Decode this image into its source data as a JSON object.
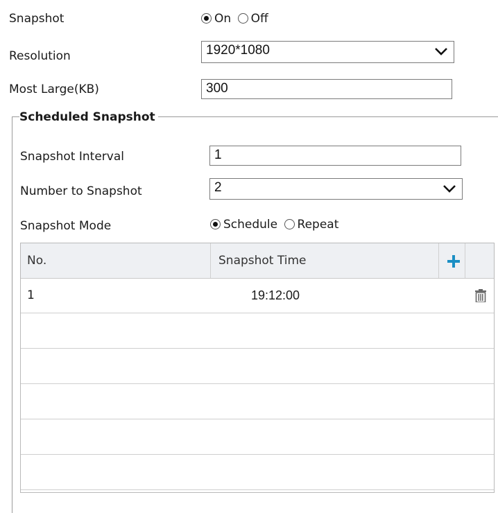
{
  "snapshot": {
    "label": "Snapshot",
    "options": [
      {
        "label": "On",
        "selected": true
      },
      {
        "label": "Off",
        "selected": false
      }
    ]
  },
  "resolution": {
    "label": "Resolution",
    "value": "1920*1080"
  },
  "max_size": {
    "label": "Most Large(KB)",
    "value": "300"
  },
  "scheduled": {
    "legend": "Scheduled Snapshot",
    "interval": {
      "label": "Snapshot Interval",
      "value": "1"
    },
    "number": {
      "label": "Number to Snapshot",
      "value": "2"
    },
    "mode": {
      "label": "Snapshot Mode",
      "options": [
        {
          "label": "Schedule",
          "selected": true
        },
        {
          "label": "Repeat",
          "selected": false
        }
      ]
    }
  },
  "table": {
    "headers": [
      "No.",
      "Snapshot Time"
    ],
    "add_icon": "plus-icon",
    "delete_icon": "trash-icon",
    "rows": [
      {
        "no": "1",
        "time": "19:12:00"
      }
    ],
    "empty_rows": 5
  },
  "colors": {
    "accent": "#1b8fc4",
    "header_bg": "#eef0f3"
  }
}
